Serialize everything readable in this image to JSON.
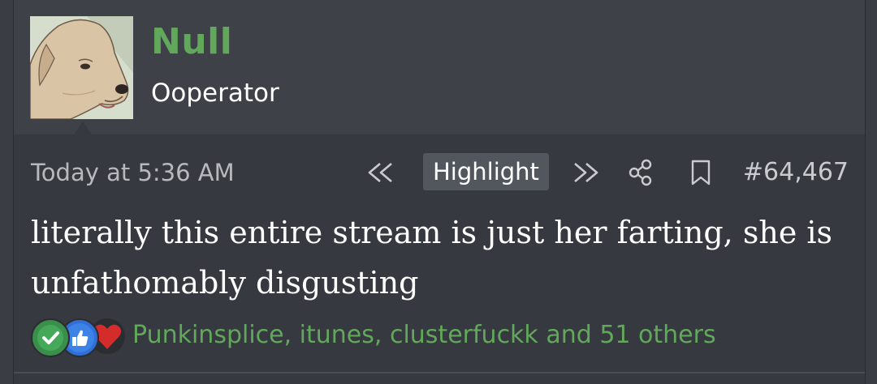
{
  "user": {
    "name": "Null",
    "title": "Ooperator",
    "avatar_icon": "dog-avatar"
  },
  "meta": {
    "timestamp": "Today at 5:36 AM",
    "highlight_label": "Highlight",
    "post_number": "#64,467",
    "icons": [
      "rewind-icon",
      "fast-forward-icon",
      "share-icon",
      "bookmark-icon"
    ]
  },
  "message": {
    "text": "literally this entire stream is just her farting, she is unfathomably disgusting"
  },
  "reactions": {
    "icons": [
      "check-reaction-icon",
      "like-reaction-icon",
      "heart-reaction-icon"
    ],
    "users_text": "Punkinsplice, itunes, clusterfuckk and 51 others"
  },
  "colors": {
    "accent_green": "#62a85b",
    "background": "#36393f",
    "header_bg": "#3e4148"
  }
}
